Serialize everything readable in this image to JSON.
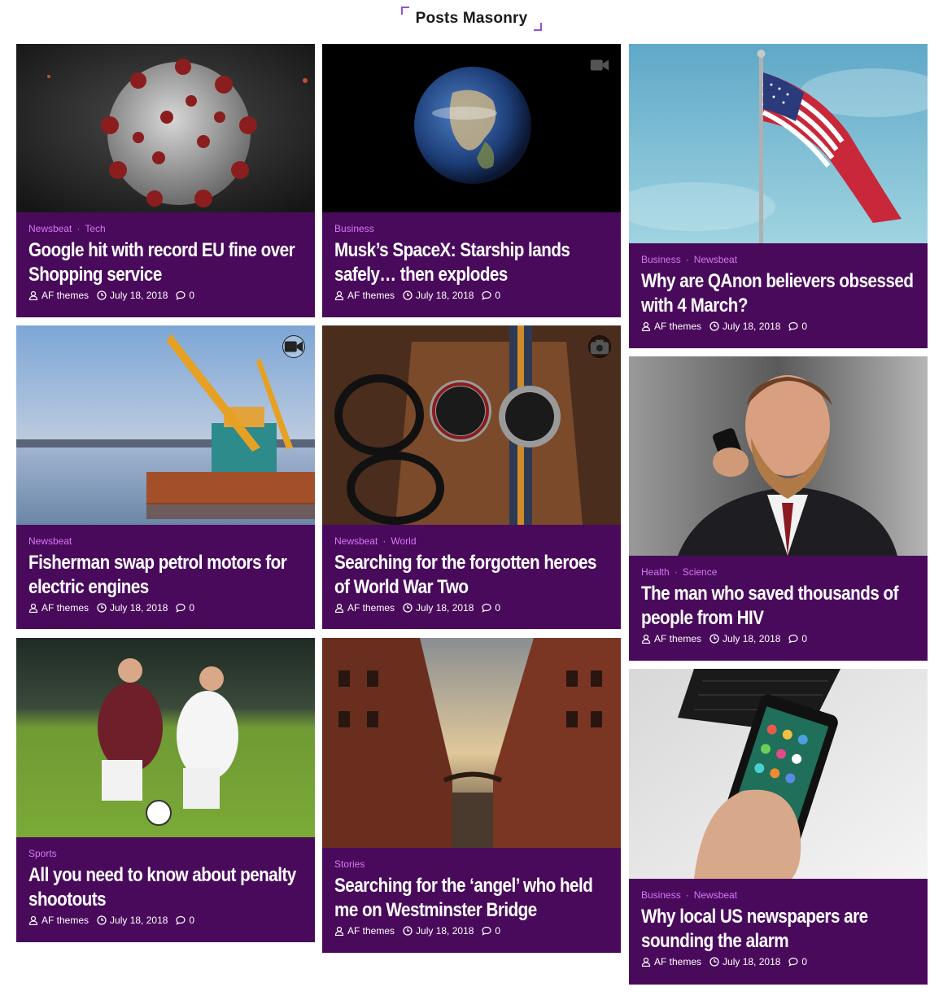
{
  "section": {
    "title": "Posts Masonry"
  },
  "colors": {
    "card_bg": "#4a0a5c",
    "category": "#d776f5",
    "accent": "#9b4fd1"
  },
  "posts": [
    {
      "categories": [
        "Newsbeat",
        "Tech"
      ],
      "title": "Google hit with record EU fine over Shopping service",
      "author": "AF themes",
      "date": "July 18, 2018",
      "comments": "0",
      "format": ""
    },
    {
      "categories": [
        "Business"
      ],
      "title": "Musk’s SpaceX: Starship lands safely… then explodes",
      "author": "AF themes",
      "date": "July 18, 2018",
      "comments": "0",
      "format": "video-icon"
    },
    {
      "categories": [
        "Business",
        "Newsbeat"
      ],
      "title": "Why are QAnon believers obsessed with 4 March?",
      "author": "AF themes",
      "date": "July 18, 2018",
      "comments": "0",
      "format": ""
    },
    {
      "categories": [
        "Newsbeat"
      ],
      "title": "Fisherman swap petrol motors for electric engines",
      "author": "AF themes",
      "date": "July 18, 2018",
      "comments": "0",
      "format": "video-icon"
    },
    {
      "categories": [
        "Newsbeat",
        "World"
      ],
      "title": "Searching for the forgotten heroes of World War Two",
      "author": "AF themes",
      "date": "July 18, 2018",
      "comments": "0",
      "format": "camera-icon"
    },
    {
      "categories": [
        "Health",
        "Science"
      ],
      "title": "The man who saved thousands of people from HIV",
      "author": "AF themes",
      "date": "July 18, 2018",
      "comments": "0",
      "format": ""
    },
    {
      "categories": [
        "Sports"
      ],
      "title": "All you need to know about penalty shootouts",
      "author": "AF themes",
      "date": "July 18, 2018",
      "comments": "0",
      "format": ""
    },
    {
      "categories": [
        "Stories"
      ],
      "title": "Searching for the ‘angel’ who held me on Westminster Bridge",
      "author": "AF themes",
      "date": "July 18, 2018",
      "comments": "0",
      "format": ""
    },
    {
      "categories": [
        "Business",
        "Newsbeat"
      ],
      "title": "Why local US newspapers are sounding the alarm",
      "author": "AF themes",
      "date": "July 18, 2018",
      "comments": "0",
      "format": ""
    }
  ]
}
